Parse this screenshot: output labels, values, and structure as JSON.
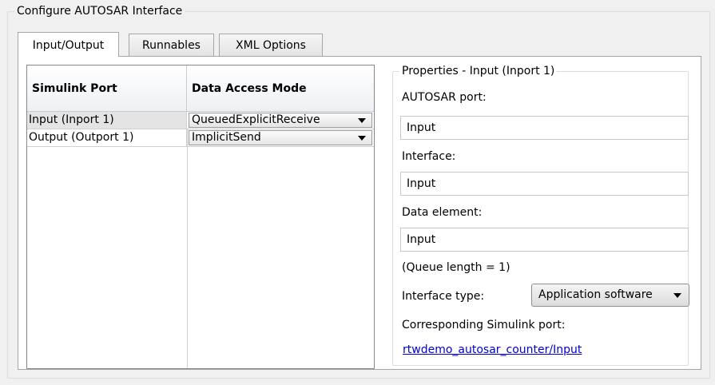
{
  "group": {
    "title": "Configure AUTOSAR Interface"
  },
  "tabs": [
    {
      "label": "Input/Output",
      "active": true
    },
    {
      "label": "Runnables",
      "active": false
    },
    {
      "label": "XML Options",
      "active": false
    }
  ],
  "table": {
    "headers": [
      "Simulink Port",
      "Data Access Mode"
    ],
    "rows": [
      {
        "port": "Input (Inport 1)",
        "mode": "QueuedExplicitReceive",
        "selected": true
      },
      {
        "port": "Output (Outport 1)",
        "mode": "ImplicitSend",
        "selected": false
      }
    ]
  },
  "properties": {
    "title": "Properties - Input (Inport 1)",
    "autosar_port_label": "AUTOSAR port:",
    "autosar_port_value": "Input",
    "interface_label": "Interface:",
    "interface_value": "Input",
    "data_element_label": "Data element:",
    "data_element_value": "Input",
    "queue_length_text": "(Queue length = 1)",
    "interface_type_label": "Interface type:",
    "interface_type_value": "Application software",
    "corresponding_label": "Corresponding Simulink port:",
    "corresponding_link": "rtwdemo_autosar_counter/Input"
  },
  "icons": {
    "dropdown": "chevron-down-icon"
  },
  "colors": {
    "link": "#0000cc",
    "background": "#f0f0f0",
    "panel": "#ffffff"
  }
}
